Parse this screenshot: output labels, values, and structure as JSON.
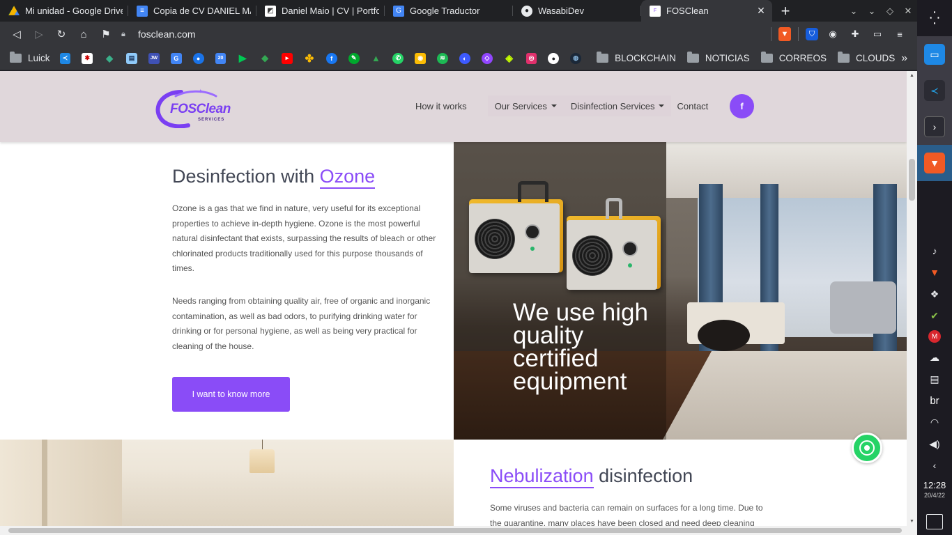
{
  "browser": {
    "tabs": [
      {
        "label": "Mi unidad - Google Drive",
        "icon": "google-drive-icon",
        "active": false
      },
      {
        "label": "Copia de CV DANIEL MAIO",
        "icon": "google-docs-icon",
        "active": false
      },
      {
        "label": "Daniel Maio | CV | Portfolio",
        "icon": "portfolio-icon",
        "active": false
      },
      {
        "label": "Google Traductor",
        "icon": "google-translate-icon",
        "active": false
      },
      {
        "label": "WasabiDev",
        "icon": "github-icon",
        "active": false
      },
      {
        "label": "FOSClean",
        "icon": "fosclean-icon",
        "active": true
      }
    ],
    "url": "fosclean.com",
    "bookmarks": {
      "first_label": "Luick",
      "folders": [
        "BLOCKCHAIN",
        "NOTICIAS",
        "CORREOS",
        "CLOUDS"
      ]
    }
  },
  "os": {
    "language": "br",
    "time": "12:28",
    "date": "20/4/22"
  },
  "site": {
    "logo_text": "FOSClean",
    "logo_subtext": "SERVICES",
    "nav": {
      "how_it_works": "How it works",
      "our_services": "Our Services",
      "disinfection_services": "Disinfection Services",
      "contact": "Contact",
      "facebook": "f"
    },
    "ozone": {
      "title_prefix": "Desinfection with ",
      "title_highlight": "Ozone",
      "paragraph_1": "Ozone is a gas that we find in nature, very useful for its exceptional properties to achieve in-depth hygiene. Ozone is the most powerful natural disinfectant that exists, surpassing the results of bleach or other chlorinated products traditionally used for this purpose thousands of times.",
      "paragraph_2": "Needs ranging from obtaining quality air, free of organic and inorganic contamination, as well as bad odors, to purifying drinking water for drinking or for personal hygiene, as well as being very practical for cleaning of the house.",
      "cta": "I want to know more",
      "promo_text": "We use high quality certified equipment"
    },
    "nebulization": {
      "title_highlight": "Nebulization",
      "title_suffix": " disinfection",
      "paragraph": "Some viruses and bacteria can remain on surfaces for a long time. Due to the quarantine, many places have been closed and need deep cleaning"
    }
  },
  "colors": {
    "brand_purple": "#8a4cf7",
    "header_bg": "#e0d7db",
    "whatsapp_green": "#25d366"
  }
}
